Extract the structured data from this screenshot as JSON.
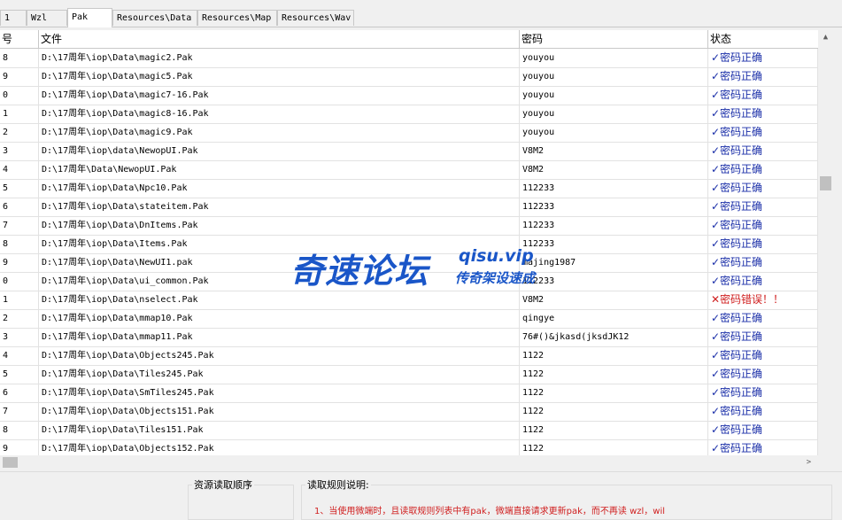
{
  "tabs": [
    "1",
    "Wzl",
    "Pak",
    "Resources\\Data",
    "Resources\\Map",
    "Resources\\Wav"
  ],
  "table": {
    "headers": {
      "no": "号",
      "file": "文件",
      "password": "密码",
      "status": "状态"
    },
    "rows": [
      {
        "no": "8",
        "file": "D:\\17周年\\iop\\Data\\magic2.Pak",
        "password": "youyou",
        "status": "✓密码正确",
        "ok": true
      },
      {
        "no": "9",
        "file": "D:\\17周年\\iop\\Data\\magic5.Pak",
        "password": "youyou",
        "status": "✓密码正确",
        "ok": true
      },
      {
        "no": "0",
        "file": "D:\\17周年\\iop\\Data\\magic7-16.Pak",
        "password": "youyou",
        "status": "✓密码正确",
        "ok": true
      },
      {
        "no": "1",
        "file": "D:\\17周年\\iop\\Data\\magic8-16.Pak",
        "password": "youyou",
        "status": "✓密码正确",
        "ok": true
      },
      {
        "no": "2",
        "file": "D:\\17周年\\iop\\Data\\magic9.Pak",
        "password": "youyou",
        "status": "✓密码正确",
        "ok": true
      },
      {
        "no": "3",
        "file": "D:\\17周年\\iop\\data\\NewopUI.Pak",
        "password": "V8M2",
        "status": "✓密码正确",
        "ok": true
      },
      {
        "no": "4",
        "file": "D:\\17周年\\Data\\NewopUI.Pak",
        "password": "V8M2",
        "status": "✓密码正确",
        "ok": true
      },
      {
        "no": "5",
        "file": "D:\\17周年\\iop\\Data\\Npc10.Pak",
        "password": "112233",
        "status": "✓密码正确",
        "ok": true
      },
      {
        "no": "6",
        "file": "D:\\17周年\\iop\\Data\\stateitem.Pak",
        "password": "112233",
        "status": "✓密码正确",
        "ok": true
      },
      {
        "no": "7",
        "file": "D:\\17周年\\iop\\Data\\DnItems.Pak",
        "password": "112233",
        "status": "✓密码正确",
        "ok": true
      },
      {
        "no": "8",
        "file": "D:\\17周年\\iop\\Data\\Items.Pak",
        "password": "112233",
        "status": "✓密码正确",
        "ok": true
      },
      {
        "no": "9",
        "file": "D:\\17周年\\iop\\Data\\NewUI1.pak",
        "password": "majing1987",
        "status": "✓密码正确",
        "ok": true
      },
      {
        "no": "0",
        "file": "D:\\17周年\\iop\\Data\\ui_common.Pak",
        "password": "112233",
        "status": "✓密码正确",
        "ok": true
      },
      {
        "no": "1",
        "file": "D:\\17周年\\iop\\Data\\nselect.Pak",
        "password": "V8M2",
        "status": "✕密码错误！！",
        "ok": false
      },
      {
        "no": "2",
        "file": "D:\\17周年\\iop\\Data\\mmap10.Pak",
        "password": "qingye",
        "status": "✓密码正确",
        "ok": true
      },
      {
        "no": "3",
        "file": "D:\\17周年\\iop\\Data\\mmap11.Pak",
        "password": "76#()&jkasd(jksdJK12",
        "status": "✓密码正确",
        "ok": true
      },
      {
        "no": "4",
        "file": "D:\\17周年\\iop\\Data\\Objects245.Pak",
        "password": "1122",
        "status": "✓密码正确",
        "ok": true
      },
      {
        "no": "5",
        "file": "D:\\17周年\\iop\\Data\\Tiles245.Pak",
        "password": "1122",
        "status": "✓密码正确",
        "ok": true
      },
      {
        "no": "6",
        "file": "D:\\17周年\\iop\\Data\\SmTiles245.Pak",
        "password": "1122",
        "status": "✓密码正确",
        "ok": true
      },
      {
        "no": "7",
        "file": "D:\\17周年\\iop\\Data\\Objects151.Pak",
        "password": "1122",
        "status": "✓密码正确",
        "ok": true
      },
      {
        "no": "8",
        "file": "D:\\17周年\\iop\\Data\\Tiles151.Pak",
        "password": "1122",
        "status": "✓密码正确",
        "ok": true
      },
      {
        "no": "9",
        "file": "D:\\17周年\\iop\\Data\\Objects152.Pak",
        "password": "1122",
        "status": "✓密码正确",
        "ok": true
      }
    ]
  },
  "bottom": {
    "left_title": "资源读取顺序",
    "right_title": "读取规则说明:",
    "rule_text": "1、当使用微端时，且读取规则列表中有pak，微端直接请求更新pak，而不再读 wzl，wil"
  },
  "watermark": {
    "cn": "奇速论坛",
    "en": "qisu.vip",
    "sub": "传奇架设速成"
  },
  "colors": {
    "ok": "#1a2ea8",
    "error": "#d02020",
    "watermark": "#1a56c8"
  }
}
